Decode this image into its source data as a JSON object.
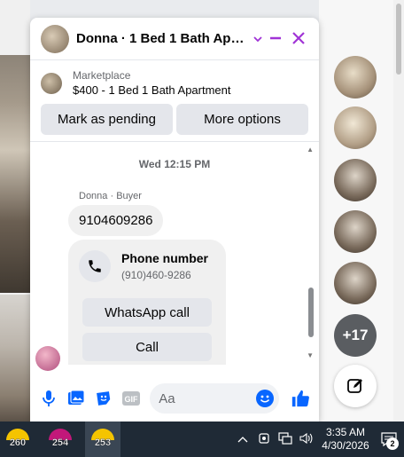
{
  "chat": {
    "title": "Donna · 1 Bed 1 Bath Apart···",
    "marketplace_label": "Marketplace",
    "listing_title": "$400 - 1 Bed 1 Bath Apartment",
    "mark_pending_label": "Mark as pending",
    "more_options_label": "More options",
    "timestamp": "Wed 12:15 PM",
    "sender_label": "Donna · Buyer",
    "phone_message": "9104609286",
    "phone_card": {
      "title": "Phone number",
      "value": "(910)460-9286",
      "whatsapp_label": "WhatsApp call",
      "call_label": "Call"
    },
    "composer": {
      "placeholder": "Aa"
    }
  },
  "rail": {
    "more_count": "+17"
  },
  "taskbar": {
    "apps": [
      {
        "value": "260",
        "color": "#f5c400"
      },
      {
        "value": "254",
        "color": "#c2187a"
      },
      {
        "value": "253",
        "color": "#f5c400"
      }
    ],
    "time": "3:35 AM",
    "date": "4/30/2026",
    "notification_count": "2"
  },
  "colors": {
    "accent": "#a033d6",
    "messenger_blue": "#0866ff",
    "taskbar_bg": "#1f2a36"
  }
}
